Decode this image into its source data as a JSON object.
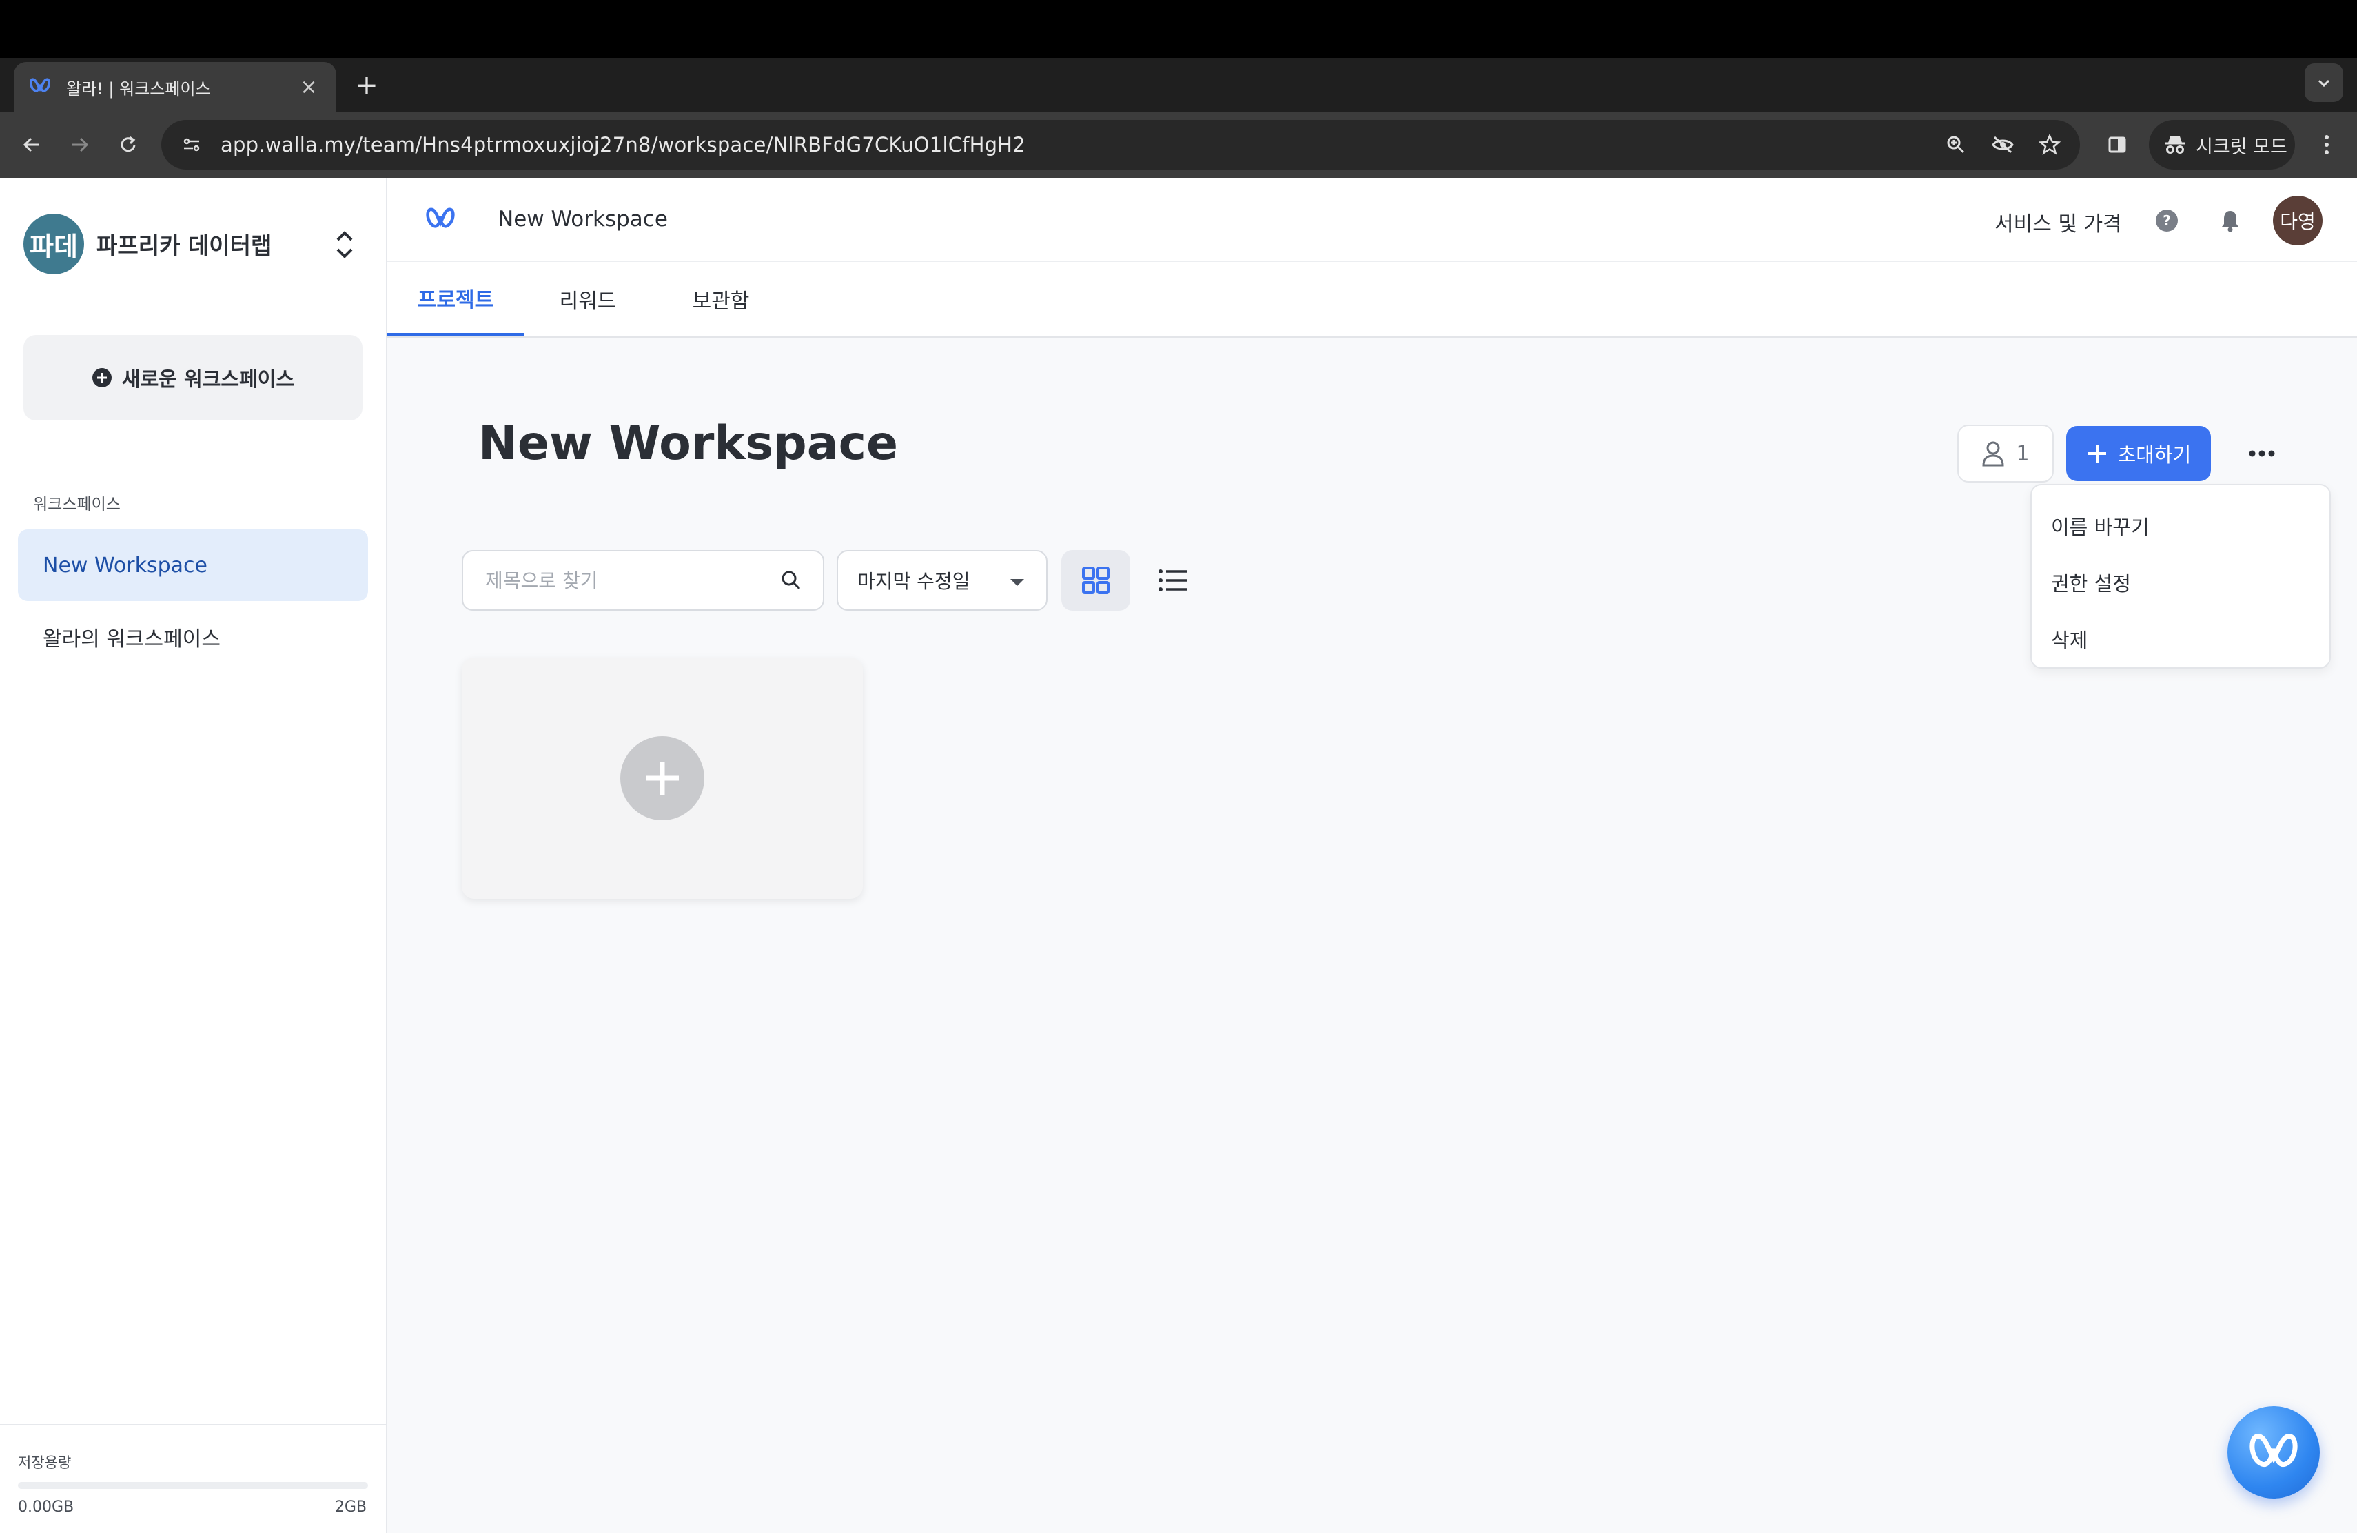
{
  "browser": {
    "tab_title": "왈라! | 워크스페이스",
    "url": "app.walla.my/team/Hns4ptrmoxuxjioj27n8/workspace/NlRBFdG7CKuO1lCfHgH2",
    "incognito_label": "시크릿 모드"
  },
  "sidebar": {
    "team_avatar": "파데",
    "team_name": "파프리카 데이터랩",
    "new_workspace_label": "새로운 워크스페이스",
    "section_label": "워크스페이스",
    "workspaces": [
      {
        "label": "New Workspace",
        "active": true
      },
      {
        "label": "왈라의 워크스페이스",
        "active": false
      }
    ],
    "storage": {
      "label": "저장용량",
      "used": "0.00GB",
      "total": "2GB",
      "used_fraction": 0
    }
  },
  "header": {
    "breadcrumb": "New Workspace",
    "service_link": "서비스 및 가격",
    "user_avatar": "다영"
  },
  "tabs": [
    {
      "label": "프로젝트",
      "active": true
    },
    {
      "label": "리워드",
      "active": false
    },
    {
      "label": "보관함",
      "active": false
    }
  ],
  "content": {
    "title": "New Workspace",
    "member_count": "1",
    "invite_label": "초대하기",
    "menu_items": [
      "이름 바꾸기",
      "권한 설정",
      "삭제"
    ],
    "search_placeholder": "제목으로 찾기",
    "sort_value": "마지막 수정일"
  },
  "colors": {
    "accent": "#3b73f0",
    "active_nav_bg": "#e3edfb",
    "team_avatar_bg": "#3f7a8f",
    "user_avatar_bg": "#5a3e37"
  }
}
